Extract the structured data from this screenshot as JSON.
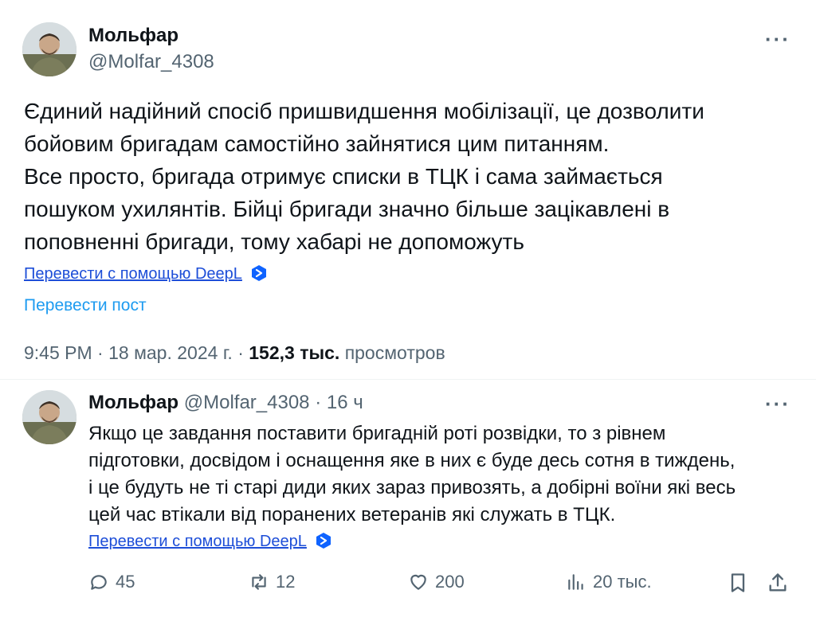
{
  "post": {
    "author_name": "Мольфар",
    "author_handle": "@Molfar_4308",
    "more": "···",
    "text": "Єдиний надійний спосіб пришвидшення мобілізації, це дозволити\nбойовим бригадам самостійно зайнятися цим питанням.\nВсе просто, бригада отримує списки в ТЦК і сама займається\nпошуком ухилянтів. Бійці бригади значно більше зацікавлені в\nпоповненні бригади, тому хабарі не допоможуть",
    "deepl_link": "Перевести с помощью DeepL",
    "translate_link": "Перевести пост",
    "time": "9:45 PM",
    "date": "18 мар. 2024 г.",
    "views_count": "152,3 тыс.",
    "views_label": "просмотров"
  },
  "reply": {
    "author_name": "Мольфар",
    "author_handle": "@Molfar_4308",
    "age": "16 ч",
    "more": "···",
    "text": "Якщо це завдання поставити бригадній роті розвідки, то з рівнем\nпідготовки, досвідом і оснащення яке в них є буде десь сотня в тиждень,\nі це будуть не ті старі диди яких зараз привозять, а добірні воїни які весь\nцей час втікали від поранених ветеранів які служать в ТЦК.",
    "deepl_link": "Перевести с помощью DeepL",
    "actions": {
      "replies": "45",
      "reposts": "12",
      "likes": "200",
      "views": "20 тыс."
    }
  },
  "icons": [
    "avatar",
    "more-icon",
    "deepl-icon",
    "reply-icon",
    "repost-icon",
    "like-icon",
    "views-icon",
    "bookmark-icon",
    "share-icon"
  ],
  "colors": {
    "link": "#1d9bf0",
    "secondary": "#536471",
    "text": "#0f1419",
    "deepl": "#0f63ff"
  }
}
